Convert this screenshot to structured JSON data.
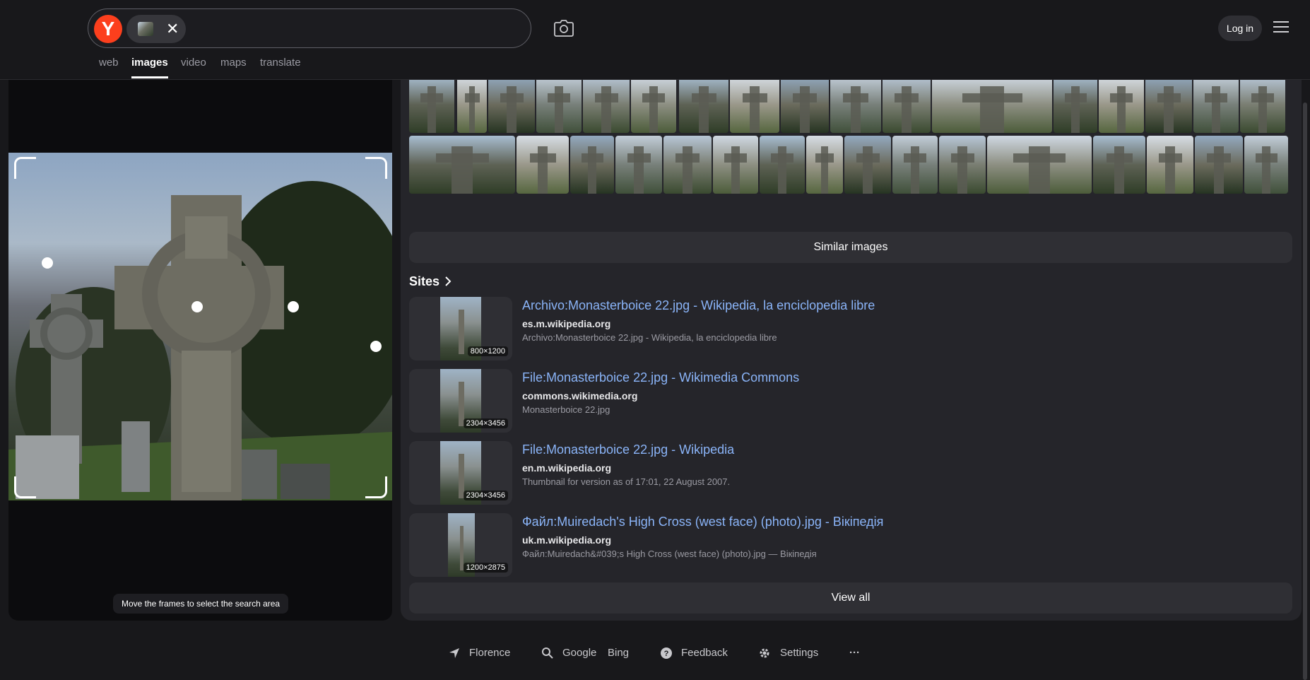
{
  "header": {
    "logo_letter": "Y",
    "clear_label": "✕",
    "login_label": "Log in",
    "tabs": [
      {
        "label": "web",
        "active": false
      },
      {
        "label": "images",
        "active": true
      },
      {
        "label": "video",
        "active": false
      },
      {
        "label": "maps",
        "active": false
      },
      {
        "label": "translate",
        "active": false
      }
    ]
  },
  "left_panel": {
    "hint": "Move the frames to select the search area"
  },
  "similar": {
    "button_label": "Similar images"
  },
  "sites": {
    "title": "Sites",
    "items": [
      {
        "title": "Archivo:Monasterboice 22.jpg - Wikipedia, la enciclopedia libre",
        "domain": "es.m.wikipedia.org",
        "desc": "Archivo:Monasterboice 22.jpg - Wikipedia, la enciclopedia libre",
        "dims": "800×1200"
      },
      {
        "title": "File:Monasterboice 22.jpg - Wikimedia Commons",
        "domain": "commons.wikimedia.org",
        "desc": "Monasterboice 22.jpg",
        "dims": "2304×3456"
      },
      {
        "title": "File:Monasterboice 22.jpg - Wikipedia",
        "domain": "en.m.wikipedia.org",
        "desc": "Thumbnail for version as of 17:01, 22 August 2007.",
        "dims": "2304×3456"
      },
      {
        "title": "Файл:Muiredach's High Cross (west face) (photo).jpg - Вікіпедія",
        "domain": "uk.m.wikipedia.org",
        "desc": "Файл:Muiredach&#039;s High Cross (west face) (photo).jpg — Вікіпедія",
        "dims": "1200×2875"
      }
    ],
    "view_all_label": "View all"
  },
  "footer": {
    "location": "Florence",
    "google": "Google",
    "bing": "Bing",
    "feedback": "Feedback",
    "settings": "Settings",
    "more": "···"
  },
  "colors": {
    "background": "#18181b",
    "panel": "#25252a",
    "button": "#2f2f34",
    "link": "#8ab4f8",
    "logo": "#fc3f1d"
  }
}
